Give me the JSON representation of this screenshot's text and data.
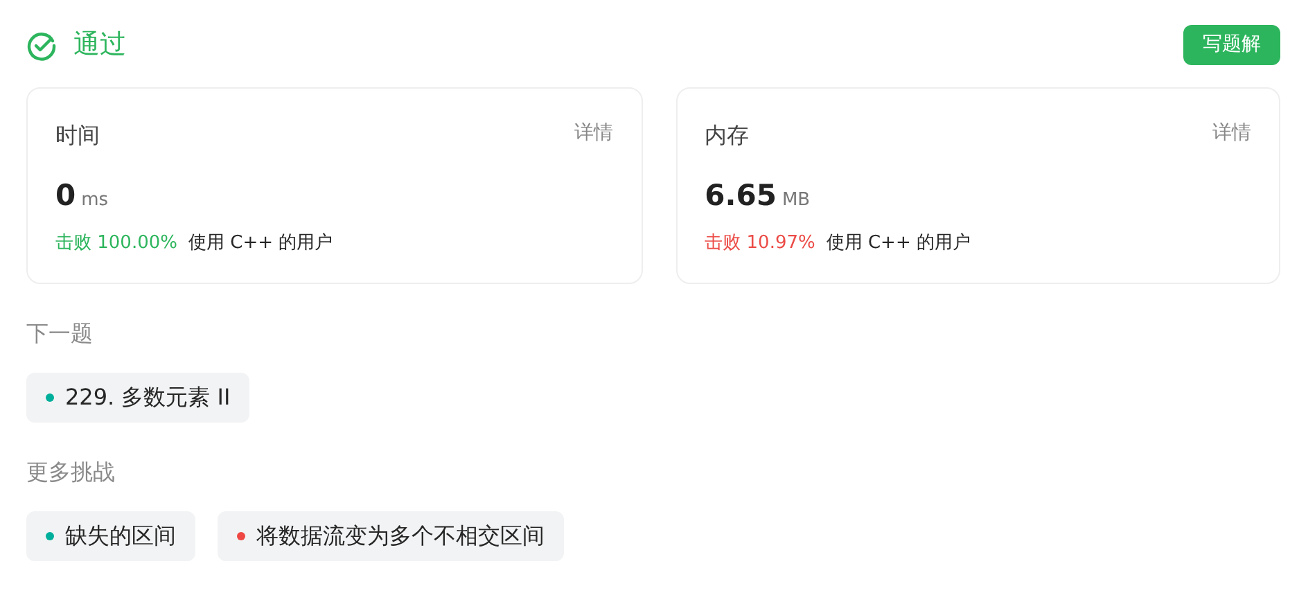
{
  "status": {
    "label": "通过"
  },
  "solution_button": "写题解",
  "stats": [
    {
      "title": "时间",
      "details": "详情",
      "value": "0",
      "unit": "ms",
      "beat": "击败 100.00%",
      "beat_suffix": "使用 C++ 的用户",
      "color": "#2db55d"
    },
    {
      "title": "内存",
      "details": "详情",
      "value": "6.65",
      "unit": "MB",
      "beat": "击败 10.97%",
      "beat_suffix": "使用 C++ 的用户",
      "color": "#ec4c47"
    }
  ],
  "next": {
    "heading": "下一题",
    "items": [
      {
        "label": "229. 多数元素 II",
        "color": "#00af9b"
      }
    ]
  },
  "more": {
    "heading": "更多挑战",
    "items": [
      {
        "label": "缺失的区间",
        "color": "#00af9b"
      },
      {
        "label": "将数据流变为多个不相交区间",
        "color": "#ef4743"
      }
    ]
  }
}
